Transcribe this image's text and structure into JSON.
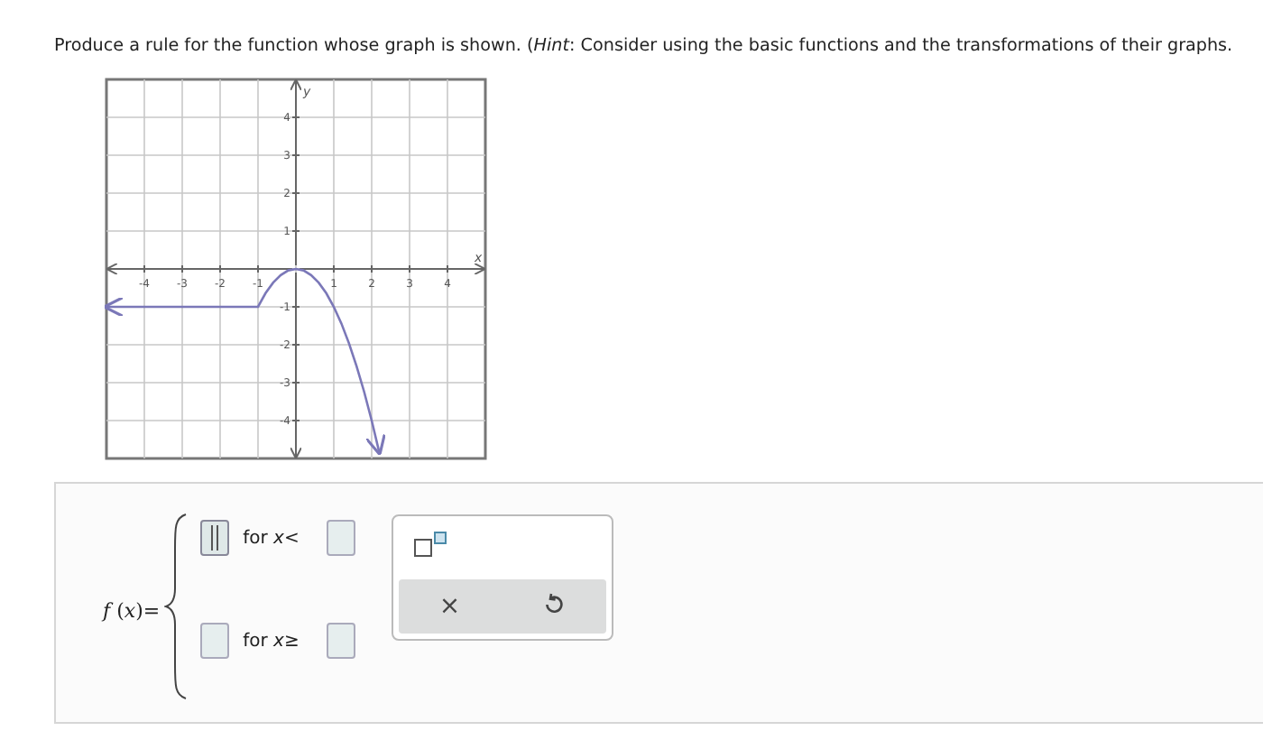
{
  "prompt": "Produce a rule for the function whose graph is shown. (*Hint*: Consider using the basic functions and the transformations of their graphs.",
  "graph": {
    "chart_data": {
      "type": "line",
      "xlabel": "x",
      "ylabel": "y",
      "xlim": [
        -5,
        5
      ],
      "ylim": [
        -5,
        5
      ],
      "xticks": [
        -4,
        -3,
        -2,
        -1,
        1,
        2,
        3,
        4
      ],
      "yticks": [
        -4,
        -3,
        -2,
        -1,
        1,
        2,
        3,
        4
      ],
      "grid": true,
      "x": [
        -5,
        -1,
        -0.8,
        -0.6,
        -0.4,
        -0.2,
        0,
        0.2,
        0.4,
        0.6,
        0.8,
        1,
        1.2,
        1.4,
        1.6,
        1.8,
        2,
        2.2
      ],
      "series": [
        {
          "color": "#7b78b8",
          "values": [
            -1,
            -1,
            -0.64,
            -0.36,
            -0.16,
            -0.04,
            0,
            -0.04,
            -0.16,
            -0.36,
            -0.64,
            -1,
            -1.44,
            -1.96,
            -2.56,
            -3.24,
            -4,
            -4.84
          ]
        }
      ]
    }
  },
  "answer": {
    "lhs": "*f* (*x*)=",
    "pieces": [
      {
        "condition": "for *x*<",
        "focused": true
      },
      {
        "condition": "for *x*≥",
        "focused": false
      }
    ],
    "toolbox": {
      "clear": "×"
    }
  }
}
